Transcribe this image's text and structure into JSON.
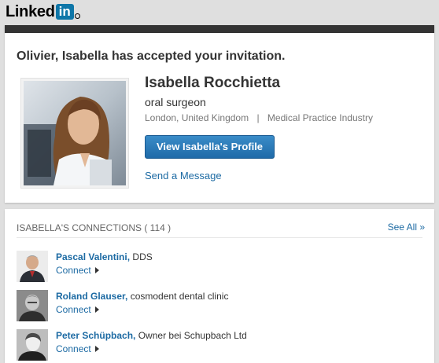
{
  "logo": {
    "text": "Linked",
    "in": "in",
    "reg": "R"
  },
  "notification": {
    "headline": "Olivier, Isabella has accepted your invitation.",
    "name": "Isabella Rocchietta",
    "title": "oral surgeon",
    "location": "London, United Kingdom",
    "separator": "|",
    "industry": "Medical Practice Industry",
    "view_profile_label": "View Isabella's Profile",
    "send_message_label": "Send a Message"
  },
  "connections": {
    "header": "ISABELLA'S CONNECTIONS ( 114 )",
    "see_all_label": "See All »",
    "items": [
      {
        "name": "Pascal Valentini,",
        "detail": "DDS",
        "connect": "Connect"
      },
      {
        "name": "Roland Glauser,",
        "detail": "cosmodent dental clinic",
        "connect": "Connect"
      },
      {
        "name": "Peter Schüpbach,",
        "detail": "Owner bei Schupbach Ltd",
        "connect": "Connect"
      }
    ]
  },
  "colors": {
    "brand": "#0e76a8",
    "link": "#1c6aa3",
    "button": "#2a77b8",
    "top_bar": "#333333"
  }
}
